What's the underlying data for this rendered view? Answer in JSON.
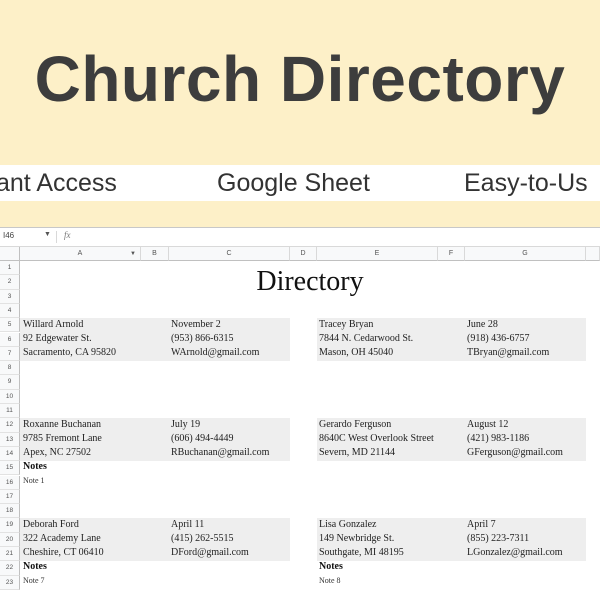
{
  "banner": {
    "title": "Church Directory",
    "features": [
      "ant Access",
      "Google Sheet",
      "Easy-to-Us"
    ]
  },
  "spreadsheet": {
    "name_box": "I46",
    "fx_symbol": "fx",
    "columns": [
      "A",
      "B",
      "C",
      "D",
      "E",
      "F",
      "G"
    ],
    "rows": [
      "1",
      "2",
      "3",
      "4",
      "5",
      "6",
      "7",
      "8",
      "9",
      "10",
      "11",
      "12",
      "13",
      "14",
      "15",
      "16",
      "17",
      "18",
      "19",
      "20",
      "21",
      "22",
      "23"
    ],
    "directory_title": "Directory",
    "notes_label": "Notes",
    "entries": [
      {
        "name": "Willard Arnold",
        "address": "92 Edgewater St.",
        "city": "Sacramento, CA 95820",
        "date": "November 2",
        "phone": "(953) 866-6315",
        "email": "WArnold@gmail.com",
        "note": ""
      },
      {
        "name": "Tracey Bryan",
        "address": "7844 N. Cedarwood St.",
        "city": "Mason, OH 45040",
        "date": "June 28",
        "phone": "(918) 436-6757",
        "email": "TBryan@gmail.com",
        "note": ""
      },
      {
        "name": "Roxanne Buchanan",
        "address": "9785 Fremont Lane",
        "city": "Apex, NC 27502",
        "date": "July 19",
        "phone": "(606) 494-4449",
        "email": "RBuchanan@gmail.com",
        "note": "Note 1"
      },
      {
        "name": "Gerardo Ferguson",
        "address": "8640C West Overlook Street",
        "city": "Severn, MD 21144",
        "date": "August 12",
        "phone": "(421) 983-1186",
        "email": "GFerguson@gmail.com",
        "note": ""
      },
      {
        "name": "Deborah Ford",
        "address": "322 Academy Lane",
        "city": "Cheshire, CT 06410",
        "date": "April 11",
        "phone": "(415) 262-5515",
        "email": "DFord@gmail.com",
        "note": "Note 7"
      },
      {
        "name": "Lisa Gonzalez",
        "address": "149 Newbridge St.",
        "city": "Southgate, MI 48195",
        "date": "April 7",
        "phone": "(855) 223-7311",
        "email": "LGonzalez@gmail.com",
        "note": "Note 8"
      }
    ]
  }
}
